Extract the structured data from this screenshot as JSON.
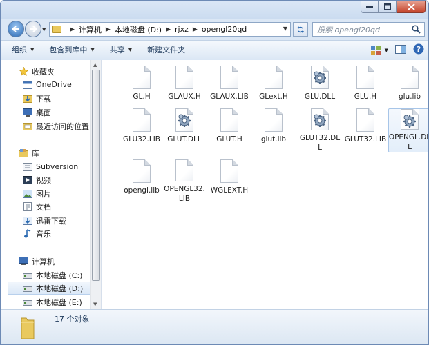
{
  "address": {
    "crumbs": [
      "计算机",
      "本地磁盘 (D:)",
      "rjxz",
      "opengl20qd"
    ]
  },
  "search": {
    "placeholder": "搜索 opengl20qd"
  },
  "toolbar": {
    "organize": "组织",
    "include_in_library": "包含到库中",
    "share": "共享",
    "new_folder": "新建文件夹"
  },
  "nav": {
    "favorites_header": "收藏夹",
    "favorites": [
      "OneDrive",
      "下载",
      "桌面",
      "最近访问的位置"
    ],
    "libraries_header": "库",
    "libraries": [
      "Subversion",
      "视频",
      "图片",
      "文档",
      "迅雷下载",
      "音乐"
    ],
    "computer_header": "计算机",
    "drives": [
      "本地磁盘 (C:)",
      "本地磁盘 (D:)",
      "本地磁盘 (E:)"
    ]
  },
  "files": [
    {
      "name": "GL.H",
      "type": "doc"
    },
    {
      "name": "GLAUX.H",
      "type": "doc"
    },
    {
      "name": "GLAUX.LIB",
      "type": "doc"
    },
    {
      "name": "GLext.H",
      "type": "doc"
    },
    {
      "name": "GLU.DLL",
      "type": "dll"
    },
    {
      "name": "GLU.H",
      "type": "doc"
    },
    {
      "name": "glu.lib",
      "type": "doc"
    },
    {
      "name": "GLU32.LIB",
      "type": "doc"
    },
    {
      "name": "GLUT.DLL",
      "type": "dll"
    },
    {
      "name": "GLUT.H",
      "type": "doc"
    },
    {
      "name": "glut.lib",
      "type": "doc"
    },
    {
      "name": "GLUT32.DLL",
      "type": "dll"
    },
    {
      "name": "GLUT32.LIB",
      "type": "doc"
    },
    {
      "name": "OPENGL.DLL",
      "type": "dll"
    },
    {
      "name": "opengl.lib",
      "type": "doc"
    },
    {
      "name": "OPENGL32.LIB",
      "type": "doc"
    },
    {
      "name": "WGLEXT.H",
      "type": "doc"
    }
  ],
  "status": {
    "count_text": "17 个对象"
  }
}
